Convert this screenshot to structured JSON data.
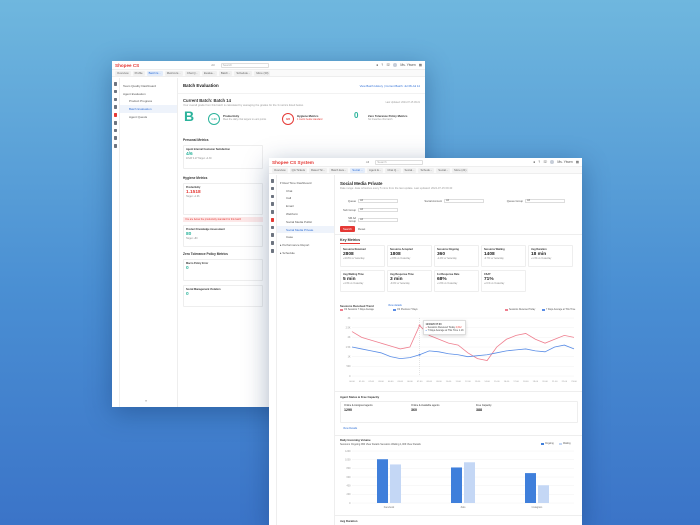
{
  "app": {
    "logo": "Shopee CS",
    "logo2": "Shopee CS System",
    "region": "All",
    "search_placeholder": "Search",
    "user": "Ms. Yiwen"
  },
  "w1": {
    "tabs": [
      "Overview",
      "Profile",
      "Batch E...",
      "Metrics E...",
      "Chat Q...",
      "Evalua...",
      "Batch...",
      "Schedule...",
      "More (30)"
    ],
    "nav": [
      "Team Quality Dashboard",
      "Agent Evaluation",
      "Product Progress",
      "Batch Evaluation",
      "Agent Quests"
    ],
    "page_title": "Batch Evaluation",
    "page_right": "View Batch History  |  Current Batch: Jul 08-Jul 14",
    "current_batch": "Current Batch: Batch 14",
    "current_sub": "Your overall grade from this batch is calculated by averaging the grades for the 3 metrics listed below.",
    "last_updated": "Last Updated: 2024-07-15 09:21",
    "grade": "B",
    "m1": {
      "ring": "1.00",
      "label": "Productivity",
      "desc": "Meet the daily chat targets to earn points"
    },
    "m2": {
      "ring": "0/3",
      "label": "Hygiene Metrics",
      "desc": "1 metric below standard"
    },
    "m3": {
      "ring": "0",
      "label": "Zero Tolerance Policy Metrics",
      "desc": "No breaches this batch"
    },
    "sec1": "Personal Metrics",
    "card1": {
      "label": "Agent Internal Customer Satisfaction",
      "value": "4/6",
      "sub": "iCSAT 4.27  Target: ≥4.30"
    },
    "sec2": "Hygiene Metrics",
    "card2": {
      "label": "Productivity",
      "value": "1.1518",
      "sub": "Target: ≥1.06"
    },
    "warn": "You are below the productivity standard for this batch",
    "card3": {
      "label": "Product Knowledge Assessment",
      "value": "80",
      "sub": "Target: ≥80"
    },
    "sec3": "Zero Tolerance Policy Metrics",
    "card4": {
      "label": "Macro Policy Error",
      "value": "0"
    },
    "card5": {
      "label": "Social Management Violation",
      "value": "0"
    }
  },
  "w2": {
    "tabs": [
      "Overview",
      "QA Tickets",
      "Rated Tic...",
      "Batch Eva...",
      "Social ...",
      "Agent E...",
      "Chat Q...",
      "Social...",
      "Schedu...",
      "Social...",
      "More (21)"
    ],
    "nav": [
      "Real Time Dashboard",
      "Chat",
      "Call",
      "Email",
      "Webform",
      "Social Media Public",
      "Social Media Private",
      "Case",
      "Performance Report",
      "Schedule"
    ],
    "page_title": "Social Media Private",
    "page_sub": "Date range: data refreshes every 5 mins from the last update. Last updated: 2024-07-15 09:40",
    "filters": [
      {
        "label": "Queue",
        "value": "All"
      },
      {
        "label": "Social Account",
        "value": "All"
      },
      {
        "label": "Queue Group",
        "value": "All"
      },
      {
        "label": "Sub Group",
        "value": "All"
      },
      {
        "label": "SM Ad Group",
        "value": "All"
      }
    ],
    "search_btn": "Search",
    "reset_btn": "Reset",
    "key_metrics": "Key Metrics",
    "metrics": [
      {
        "label": "Sessions Received",
        "value": "2808",
        "sub": "+10.8% vs Yesterday"
      },
      {
        "label": "Sessions Accepted",
        "value": "1808",
        "sub": "+3.9% vs Yesterday"
      },
      {
        "label": "Sessions Ongoing",
        "value": "360",
        "sub": "-2.4% vs Yesterday"
      },
      {
        "label": "Sessions Waiting",
        "value": "1408",
        "sub": "-6.7% vs Yesterday"
      },
      {
        "label": "Avg Duration",
        "value": "18 min",
        "sub": "+1.3% vs Yesterday"
      },
      {
        "label": "Avg Waiting Time",
        "value": "5 min",
        "sub": "+4.3% vs Yesterday"
      },
      {
        "label": "Avg Response Time",
        "value": "3 min",
        "sub": "-3.0% vs Yesterday"
      },
      {
        "label": "1st Response Rate",
        "value": "68%",
        "sub": "+1.6% vs Yesterday"
      },
      {
        "label": "CSAT",
        "value": "71%",
        "sub": "+2.1% vs Yesterday"
      }
    ],
    "trend_title": "Sessions Received Trend",
    "trend_link": "View details",
    "trend_legend": [
      "CS Sessions 7 Days Average",
      "CS Previous 7 Days"
    ],
    "trend_legend_right": [
      "Sessions Received Today",
      "7 Days Average at This Time"
    ],
    "tooltip": {
      "time": "12/13/20 07:00",
      "line1": "Sessions Received Today",
      "v1": "2,612",
      "line2": "7 Days Average at This Time",
      "v2": "1.1K"
    },
    "capacity_title": "Agent Status & Free Capacity",
    "capacity": [
      {
        "label": "Online & Assigned agents",
        "value": "1290"
      },
      {
        "label": "Online & Available agents",
        "value": "360"
      },
      {
        "label": "Free Capacity",
        "value": "388"
      }
    ],
    "capacity_link": "View Details",
    "incoming_title": "Daily Incoming Volume",
    "incoming_stats": "Sessions Ongoing  960  View Details     Sessions Waiting  1,009  View Details",
    "incoming_legend": [
      "Ongoing",
      "Waiting"
    ],
    "avg_duration": "Avg Duration"
  },
  "chart_data": {
    "type": "bar",
    "categories": [
      "Facebook",
      "Zalo",
      "Instagram"
    ],
    "series": [
      {
        "name": "Ongoing",
        "values": [
          1010,
          820,
          690
        ]
      },
      {
        "name": "Waiting",
        "values": [
          890,
          940,
          410
        ]
      }
    ],
    "colors": [
      "#3f7fdb",
      "#c4d7f5"
    ],
    "ylim": [
      0,
      1200
    ]
  },
  "trend_data": {
    "type": "line",
    "x": [
      "00:00",
      "01:00",
      "02:00",
      "03:00",
      "04:00",
      "05:00",
      "06:00",
      "07:00",
      "08:00",
      "09:00",
      "10:00",
      "11:00",
      "12:00",
      "13:00",
      "14:00",
      "15:00",
      "16:00",
      "17:00",
      "18:00",
      "19:00",
      "20:00",
      "21:00",
      "22:00",
      "23:00"
    ],
    "series": [
      {
        "name": "Sessions Received Today",
        "values": [
          2300,
          2000,
          1850,
          1700,
          1550,
          1400,
          1500,
          2612,
          2100,
          1900,
          1700,
          1600,
          1200,
          900,
          800,
          1500,
          1900,
          2100,
          2200,
          1900,
          1700,
          1900,
          2100,
          2000
        ],
        "color": "#ef7f8f"
      },
      {
        "name": "7 Days Average at This Time",
        "values": [
          1500,
          1400,
          1300,
          1200,
          1000,
          900,
          950,
          1100,
          1300,
          1250,
          1150,
          1100,
          1000,
          1050,
          1100,
          1200,
          1300,
          1350,
          1400,
          1300,
          1250,
          1500,
          1600,
          1400
        ],
        "color": "#5a8de6"
      }
    ],
    "ylim": [
      0,
      3000
    ]
  }
}
